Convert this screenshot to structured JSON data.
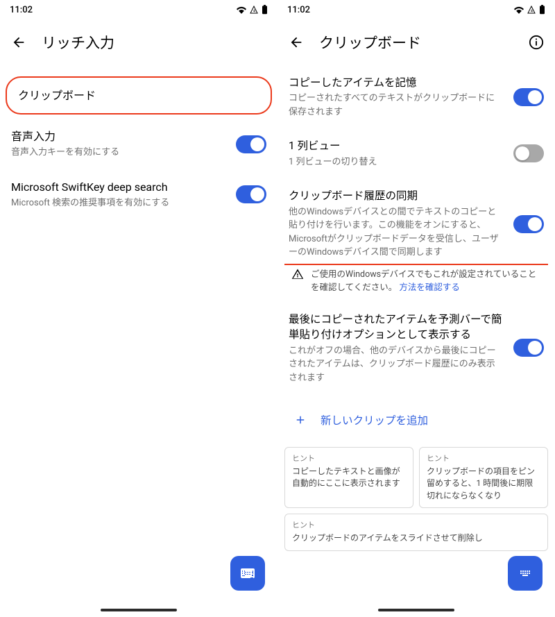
{
  "status": {
    "time": "11:02"
  },
  "left": {
    "title": "リッチ入力",
    "clipboard": "クリップボード",
    "voice": {
      "title": "音声入力",
      "sub": "音声入力キーを有効にする"
    },
    "deepsearch": {
      "title": "Microsoft SwiftKey deep search",
      "sub": "Microsoft 検索の推奨事項を有効にする"
    }
  },
  "right": {
    "title": "クリップボード",
    "remember": {
      "title": "コピーしたアイテムを記憶",
      "sub": "コピーされたすべてのテキストがクリップボードに保存されます"
    },
    "oneCol": {
      "title": "1 列ビュー",
      "sub": "1 列ビューの切り替え"
    },
    "sync": {
      "title": "クリップボード履歴の同期",
      "sub": "他のWindowsデバイスとの間でテキストのコピーと貼り付けを行います。この機能をオンにすると、Microsoftがクリップボードデータを受信し、ユーザーのWindowsデバイス間で同期します"
    },
    "warning": {
      "text": "ご使用のWindowsデバイスでもこれが設定されていることを確認してください。",
      "link": "方法を確認する"
    },
    "lastCopied": {
      "title": "最後にコピーされたアイテムを予測バーで簡単貼り付けオプションとして表示する",
      "sub": "これがオフの場合、他のデバイスから最後にコピーされたアイテムは、クリップボード履歴にのみ表示されます"
    },
    "addClip": "新しいクリップを追加",
    "hintLabel": "ヒント",
    "hints": {
      "a": "コピーしたテキストと画像が自動的にここに表示されます",
      "b": "クリップボードの項目をピン留めすると、1 時間後に期限切れにならなくなり",
      "c": "クリップボードのアイテムをスライドさせて削除し"
    }
  }
}
